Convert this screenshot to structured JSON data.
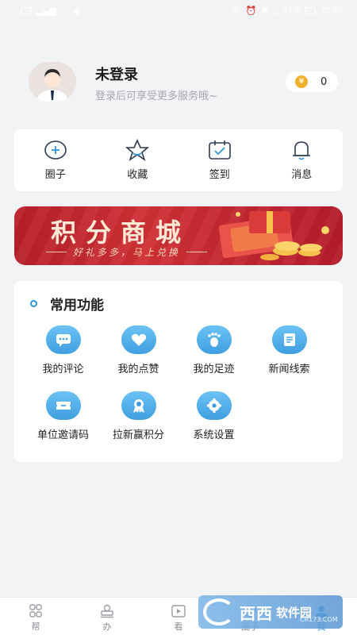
{
  "statusbar": {
    "battery": "41%",
    "time": "20:36"
  },
  "profile": {
    "title": "未登录",
    "subtitle": "登录后可享受更多服务哦~",
    "points": "0"
  },
  "quick_items": [
    {
      "label": "圈子",
      "icon": "circle-plus-icon"
    },
    {
      "label": "收藏",
      "icon": "star-icon"
    },
    {
      "label": "签到",
      "icon": "calendar-check-icon"
    },
    {
      "label": "消息",
      "icon": "bell-icon"
    }
  ],
  "banner": {
    "title": "积分商城",
    "subtitle": "好礼多多，马上兑换"
  },
  "functions": {
    "title": "常用功能",
    "items": [
      {
        "label": "我的评论",
        "icon": "comment-icon"
      },
      {
        "label": "我的点赞",
        "icon": "heart-icon"
      },
      {
        "label": "我的足迹",
        "icon": "footprint-icon"
      },
      {
        "label": "新闻线索",
        "icon": "news-icon"
      },
      {
        "label": "单位邀请码",
        "icon": "ticket-icon"
      },
      {
        "label": "拉新赢积分",
        "icon": "badge-icon"
      },
      {
        "label": "系统设置",
        "icon": "settings-icon"
      }
    ]
  },
  "bottom_nav": [
    {
      "label": "帮",
      "icon": "grid-icon"
    },
    {
      "label": "办",
      "icon": "stamp-icon"
    },
    {
      "label": "看",
      "icon": "play-icon"
    },
    {
      "label": "圈子",
      "icon": "circle-icon"
    },
    {
      "label": "我",
      "icon": "user-icon",
      "active": true
    }
  ],
  "watermark": {
    "text": "西西",
    "brand": "软件园",
    "url": "CR173.COM"
  },
  "colors": {
    "accent": "#2f95dc",
    "banner_red": "#c8282f",
    "background": "#f2f3f5"
  }
}
